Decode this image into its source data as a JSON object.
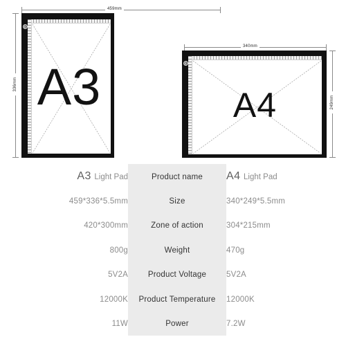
{
  "diagram": {
    "a3": {
      "screen_label": "A3",
      "width_dim": "459mm",
      "height_dim": "336mm",
      "power_button": "power-button"
    },
    "a4": {
      "screen_label": "A4",
      "width_dim": "340mm",
      "height_dim": "249mm",
      "power_button": "power-button"
    }
  },
  "spec": {
    "rows": [
      {
        "key": "Product name",
        "a3_big": "A3",
        "a3_small": "Light Pad",
        "a4_big": "A4",
        "a4_small": "Light Pad",
        "type": "product-name"
      },
      {
        "key": "Size",
        "a3": "459*336*5.5mm",
        "a4": "340*249*5.5mm",
        "type": "text"
      },
      {
        "key": "Zone of action",
        "a3": "420*300mm",
        "a4": "304*215mm",
        "type": "text"
      },
      {
        "key": "Weight",
        "a3": "800g",
        "a4": "470g",
        "type": "text"
      },
      {
        "key": "Product Voltage",
        "a3": "5V2A",
        "a4": "5V2A",
        "type": "text"
      },
      {
        "key": "Product Temperature",
        "a3": "12000K",
        "a4": "12000K",
        "type": "text"
      },
      {
        "key": "Power",
        "a3": "11W",
        "a4": "7.2W",
        "type": "text"
      }
    ]
  },
  "colors": {
    "bezel": "#111111",
    "panel_bg": "#ebebeb",
    "value_text": "#8c8c8c",
    "key_text": "#333333",
    "dimension_line": "#8a8a8a"
  }
}
